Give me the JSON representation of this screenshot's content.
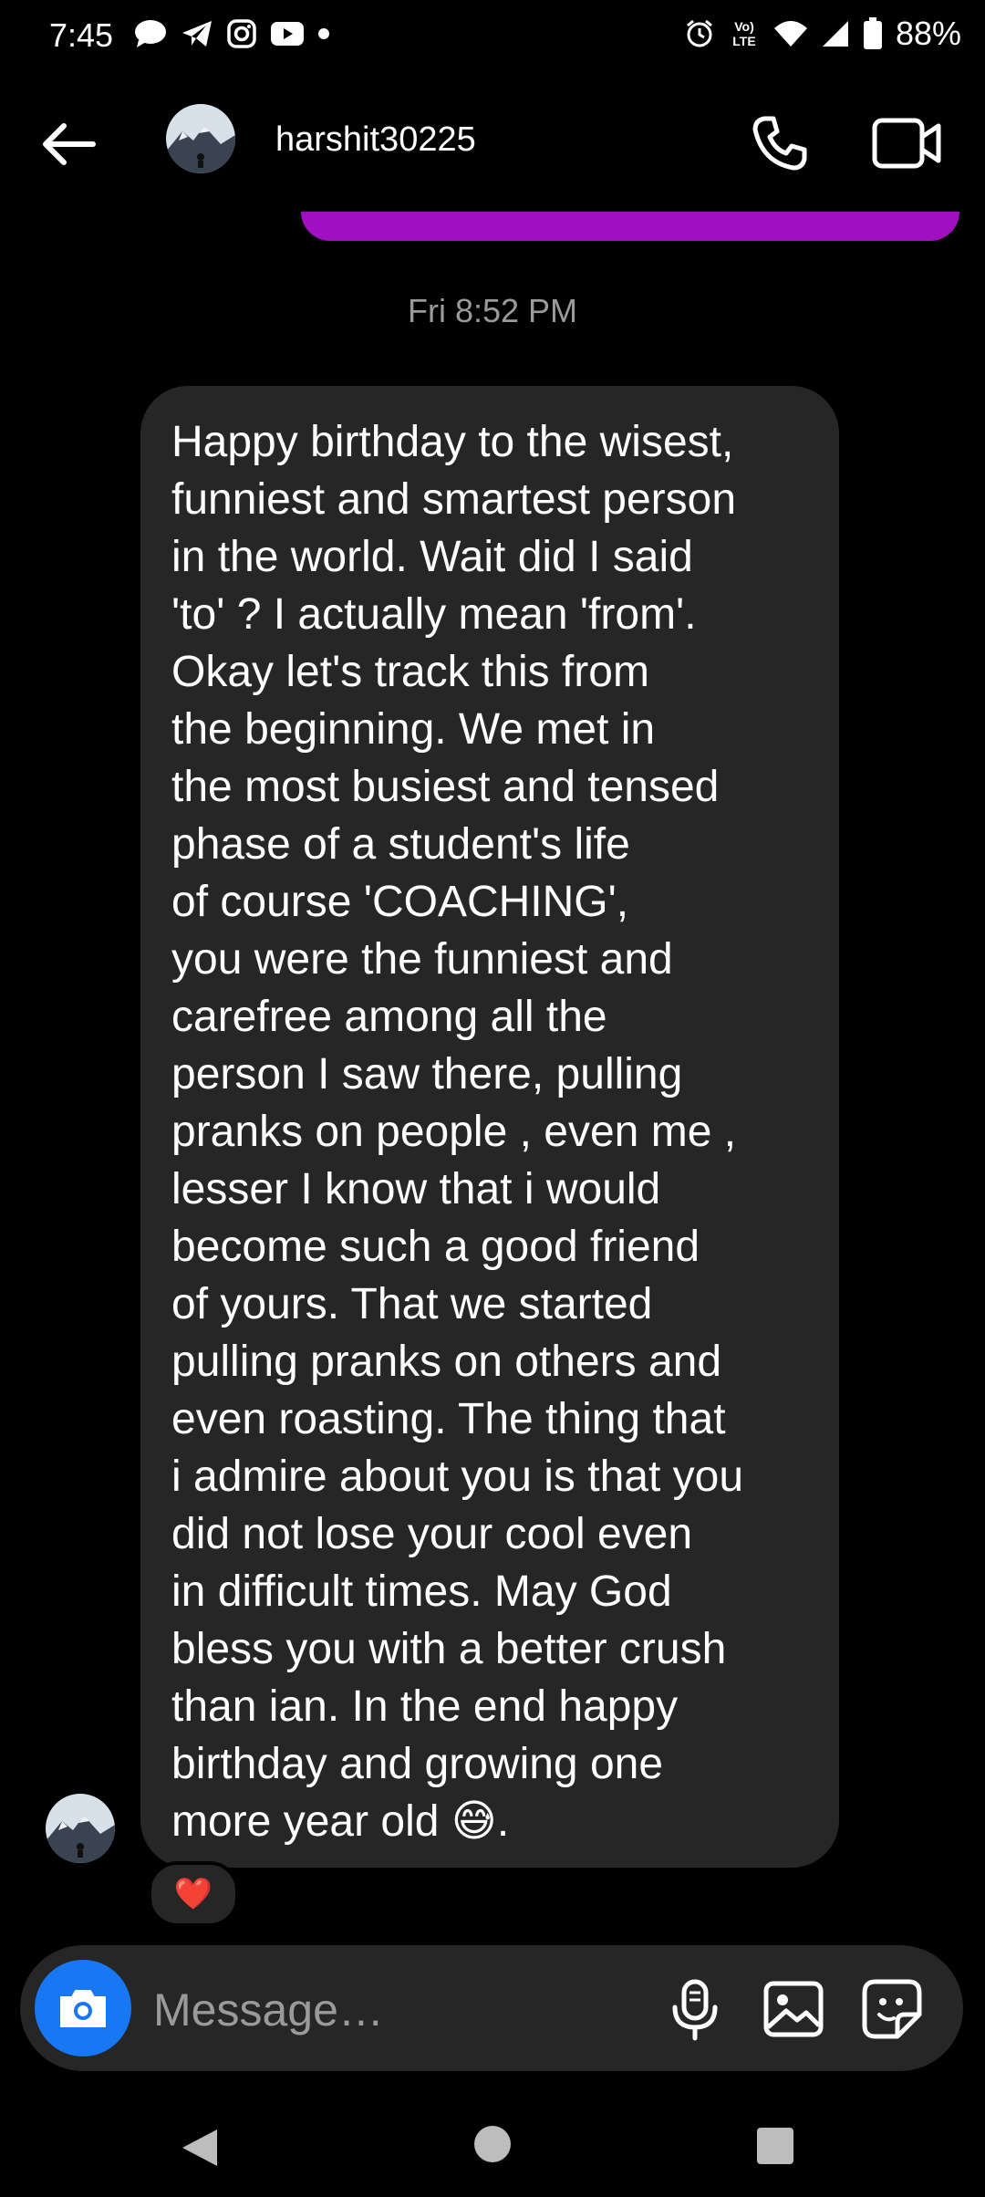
{
  "status_bar": {
    "time": "7:45",
    "left_icons": [
      "message-icon",
      "telegram-icon",
      "instagram-icon",
      "youtube-icon",
      "dot-icon"
    ],
    "right_icons": [
      "alarm-icon",
      "volte-icon",
      "wifi-icon",
      "signal-icon",
      "battery-icon"
    ],
    "volte_label": "Vo\nLTE",
    "battery": "88%"
  },
  "header": {
    "username": "harshit30225",
    "back_icon": "arrow-left-icon",
    "call_icon": "phone-icon",
    "video_icon": "video-camera-icon"
  },
  "chat": {
    "timestamp": "Fri 8:52 PM",
    "message": "Happy birthday to the wisest,\nfunniest and smartest person\nin the world. Wait did I said\n'to' ? I actually mean 'from'.\nOkay let's track this from\nthe beginning. We met in\nthe most busiest and tensed\nphase of a student's life\nof course 'COACHING',\nyou were the funniest and\ncarefree among all the\nperson I saw there, pulling\npranks on people , even me ,\nlesser I know that i would\nbecome such a good friend\nof yours. That we started\npulling pranks on others and\neven roasting. The thing that\ni admire about you is that you\ndid not lose your cool even\nin difficult times. May God\nbless you with a better crush\nthan ian. In the end happy\nbirthday and growing one\nmore year old 😅.",
    "reaction": "❤️"
  },
  "composer": {
    "placeholder": "Message…",
    "camera_icon": "camera-icon",
    "mic_icon": "microphone-icon",
    "gallery_icon": "image-icon",
    "sticker_icon": "sticker-icon"
  },
  "colors": {
    "background": "#000000",
    "bubble_received": "#262626",
    "bubble_sent": "#a010c0",
    "accent_blue": "#1877f2"
  }
}
